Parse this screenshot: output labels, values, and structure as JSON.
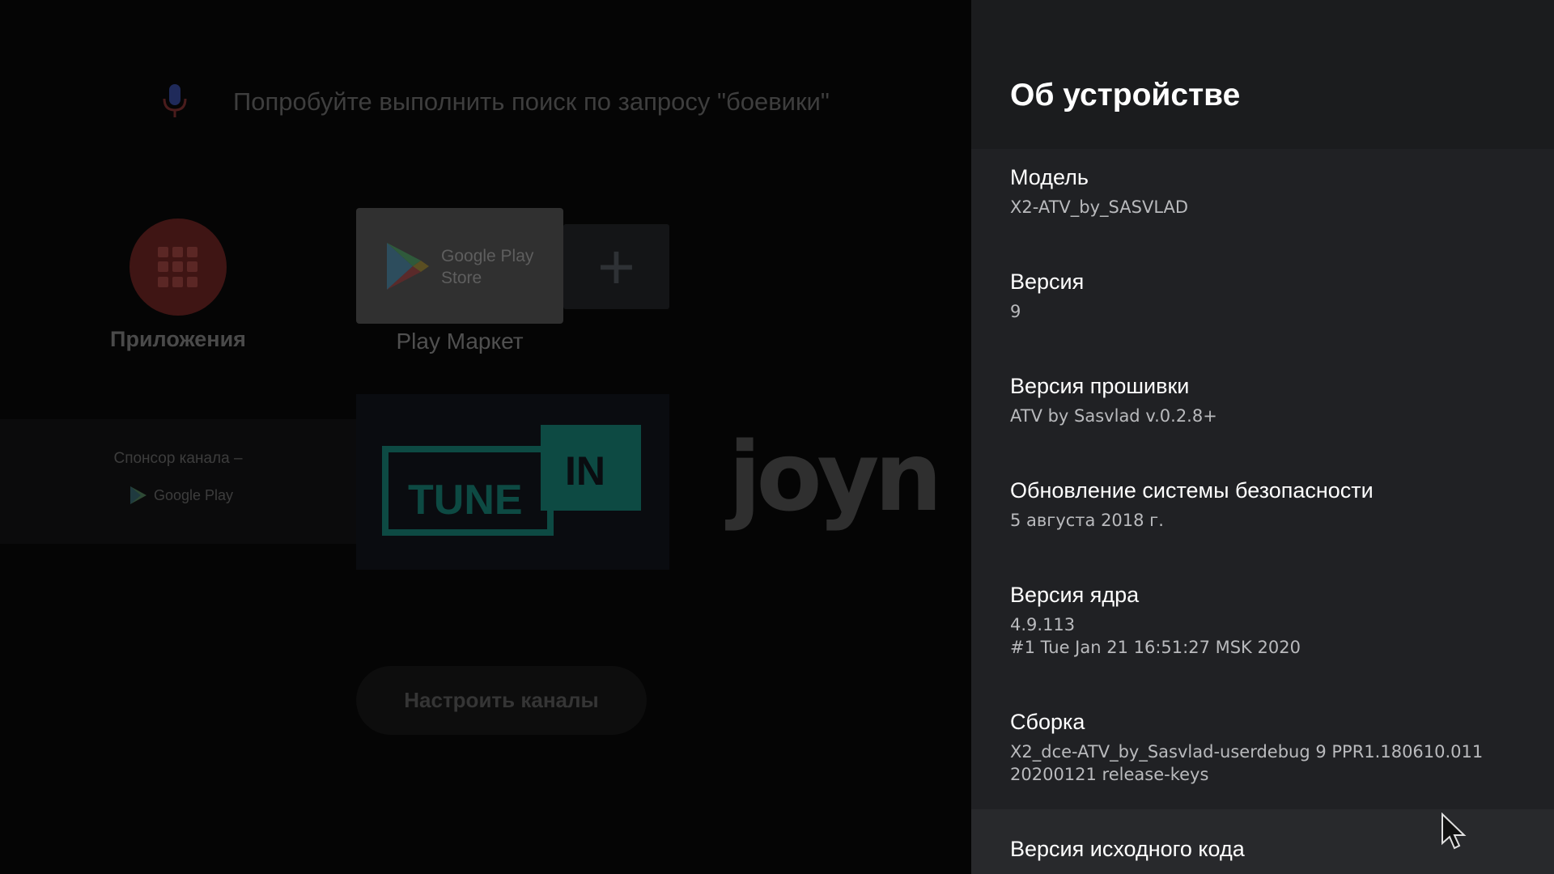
{
  "launcher": {
    "search_hint": "Попробуйте выполнить поиск по запросу \"боевики\"",
    "apps_label": "Приложения",
    "play_store_tile": {
      "line1": "Google Play",
      "line2": "Store",
      "label": "Play Маркет"
    },
    "add_tile_symbol": "+",
    "sponsor": {
      "title": "Спонсор канала –",
      "logo_text": "Google Play"
    },
    "tunein_tile": {
      "word1": "TUNE",
      "word2": "IN"
    },
    "joyn_tile_text": "joyn",
    "customize_channels_label": "Настроить каналы"
  },
  "panel": {
    "title": "Об устройстве",
    "items": [
      {
        "label": "Модель",
        "value": "X2-ATV_by_SASVLAD"
      },
      {
        "label": "Версия",
        "value": "9"
      },
      {
        "label": "Версия прошивки",
        "value": "ATV by Sasvlad v.0.2.8+"
      },
      {
        "label": "Обновление системы безопасности",
        "value": "5 августа 2018 г."
      },
      {
        "label": "Версия ядра",
        "value": "4.9.113\n#1 Tue Jan 21 16:51:27 MSK 2020"
      },
      {
        "label": "Сборка",
        "value": "X2_dce-ATV_by_Sasvlad-userdebug 9 PPR1.180610.011\n20200121 release-keys"
      },
      {
        "label": "Версия исходного кода",
        "value": ""
      }
    ]
  },
  "colors": {
    "panel_bg": "#202124",
    "panel_header_bg": "#1b1c1e",
    "dim_overlay": "#000000",
    "apps_red": "#3f1514",
    "tunein_teal": "#0d4a43"
  },
  "icons": [
    "mic-icon",
    "apps-grid-icon",
    "google-play-icon",
    "plus-icon",
    "mouse-cursor-icon"
  ]
}
